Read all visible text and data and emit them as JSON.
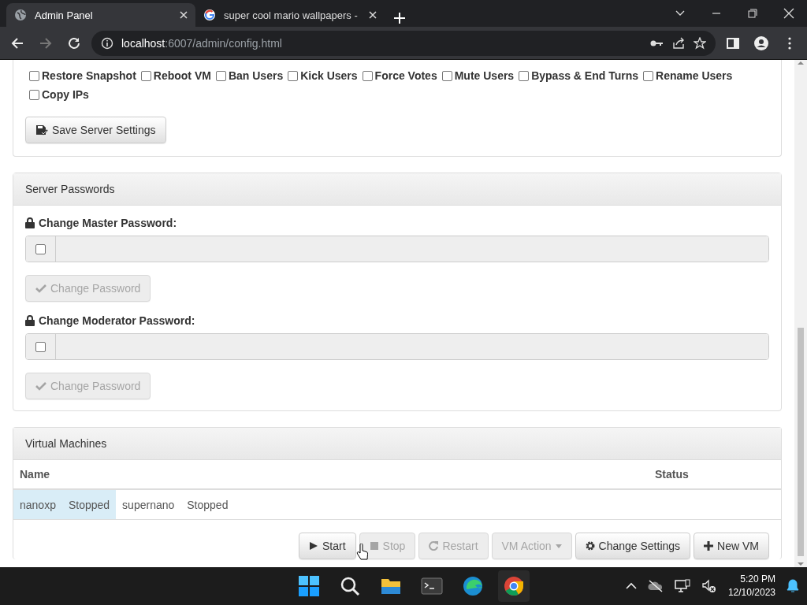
{
  "browser": {
    "tabs": [
      {
        "title": "Admin Panel",
        "selected": true
      },
      {
        "title": "super cool mario wallpapers -",
        "selected": false
      }
    ],
    "url_host": "localhost",
    "url_path": ":6007/admin/config.html"
  },
  "permissions": [
    {
      "label": "Restore Snapshot",
      "checked": false
    },
    {
      "label": "Reboot VM",
      "checked": false
    },
    {
      "label": "Ban Users",
      "checked": false
    },
    {
      "label": "Kick Users",
      "checked": false
    },
    {
      "label": "Force Votes",
      "checked": false
    },
    {
      "label": "Mute Users",
      "checked": false
    },
    {
      "label": "Bypass & End Turns",
      "checked": false
    },
    {
      "label": "Rename Users",
      "checked": false
    },
    {
      "label": "Copy IPs",
      "checked": false
    }
  ],
  "save_button": "Save Server Settings",
  "passwords": {
    "title": "Server Passwords",
    "fields": [
      {
        "label": "Change Master Password:",
        "checked": false,
        "disabled": true,
        "button": "Change Password"
      },
      {
        "label": "Change Moderator Password:",
        "checked": false,
        "disabled": true,
        "button": "Change Password"
      }
    ]
  },
  "vms": {
    "title": "Virtual Machines",
    "columns": [
      "Name",
      "Status"
    ],
    "rows": [
      {
        "name": "nanoxp",
        "status": "Stopped",
        "selected": true
      },
      {
        "name": "supernano",
        "status": "Stopped",
        "selected": false
      }
    ],
    "buttons": [
      {
        "label": "Start",
        "disabled": false
      },
      {
        "label": "Stop",
        "disabled": true
      },
      {
        "label": "Restart",
        "disabled": true
      },
      {
        "label": "VM Action",
        "disabled": true
      },
      {
        "label": "Change Settings",
        "disabled": false
      },
      {
        "label": "New VM",
        "disabled": false
      }
    ]
  },
  "taskbar": {
    "time": "5:20 PM",
    "date": "12/10/2023"
  }
}
